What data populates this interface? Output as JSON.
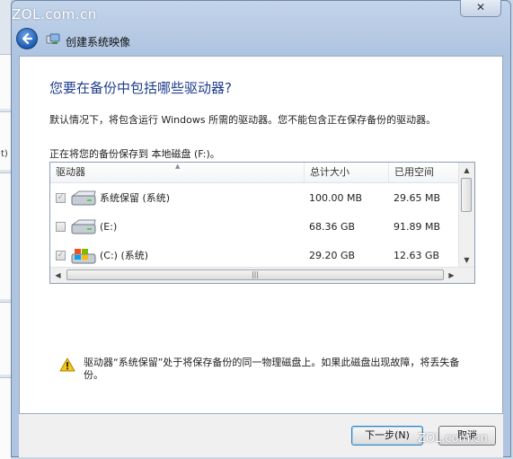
{
  "background": {
    "left_fragment": "t)"
  },
  "window": {
    "title": "创建系统映像",
    "close_symbol": "✕",
    "watermark": "ZOL.com.cn"
  },
  "heading": "您要在备份中包括哪些驱动器?",
  "description": "默认情况下，将包含运行 Windows 所需的驱动器。您不能包含正在保存备份的驱动器。",
  "save_location": "正在将您的备份保存到 本地磁盘 (F:)。",
  "table": {
    "columns": [
      "驱动器",
      "总计大小",
      "已用空间"
    ],
    "rows": [
      {
        "name": "系统保留 (系统)",
        "total": "100.00 MB",
        "used": "29.65 MB",
        "checked": true,
        "disabled": true,
        "icon": "hard-drive-icon"
      },
      {
        "name": "(E:)",
        "total": "68.36 GB",
        "used": "91.89 MB",
        "checked": false,
        "disabled": false,
        "icon": "hard-drive-icon"
      },
      {
        "name": "(C:) (系统)",
        "total": "29.20 GB",
        "used": "12.63 GB",
        "checked": true,
        "disabled": true,
        "icon": "windows-drive-icon"
      }
    ]
  },
  "warning": "驱动器“系统保留”处于将保存备份的同一物理磁盘上。如果此磁盘出现故障，将丢失备份。",
  "buttons": {
    "next": "下一步(N)",
    "cancel": "取消"
  },
  "footer_watermark": "ZOL.com.cn",
  "colors": {
    "heading": "#1e3e8c",
    "chrome": "#aec4e1",
    "warning_yellow": "#f5c518"
  }
}
